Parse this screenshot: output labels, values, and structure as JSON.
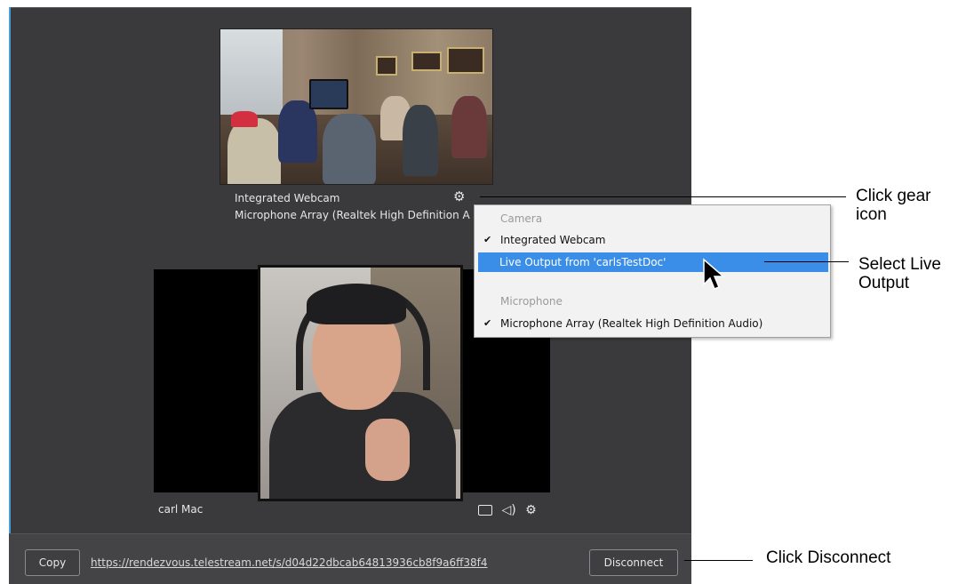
{
  "session": {
    "remote_camera_name": "Integrated Webcam",
    "remote_microphone_name": "Microphone Array (Realtek High Definition A",
    "local_user_label": "carl Mac"
  },
  "menu": {
    "camera_header": "Camera",
    "items": [
      {
        "label": "Integrated Webcam",
        "checked": true,
        "selected": false
      },
      {
        "label": "Live Output from 'carlsTestDoc'",
        "checked": false,
        "selected": true
      }
    ],
    "microphone_header": "Microphone",
    "mic_items": [
      {
        "label": "Microphone Array (Realtek High Definition Audio)",
        "checked": true
      }
    ]
  },
  "footer": {
    "copy_label": "Copy",
    "url": "https://rendezvous.telestream.net/s/d04d22dbcab64813936cb8f9a6ff38f4",
    "disconnect_label": "Disconnect"
  },
  "annotations": {
    "gear": "Click gear icon",
    "live_output": "Select Live Output",
    "disconnect": "Click Disconnect"
  },
  "colors": {
    "panel_bg": "#3a3a3d",
    "selection": "#3b8ee8",
    "accent_border": "#4a9ed8"
  },
  "icons": {
    "settings": "gear-icon",
    "camera": "video-camera-icon",
    "audio": "speaker-icon",
    "check": "checkmark-icon",
    "pointer": "mouse-cursor-icon"
  }
}
